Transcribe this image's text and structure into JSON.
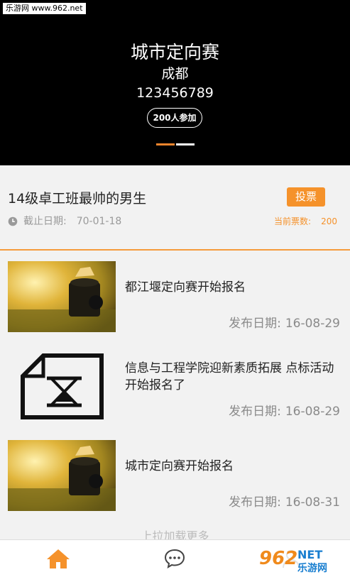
{
  "watermark": {
    "top_text": "乐游网 www.962.net",
    "logo_number": "962",
    "logo_suffix": "NET",
    "logo_text": "乐游网"
  },
  "banner": {
    "title": "城市定向赛",
    "city": "成都",
    "phone": "123456789",
    "participants": "200人参加",
    "indicator": {
      "count": 2,
      "active": 1
    },
    "colors": {
      "background": "#000000",
      "active_dot": "#f0852d"
    }
  },
  "event": {
    "name": "14级卓工班最帅的男生",
    "vote_label": "投票",
    "deadline_label": "截止日期:",
    "deadline_value": "70-01-18",
    "votes_label": "当前票数:",
    "votes_value": "200"
  },
  "news": [
    {
      "title": "都江堰定向赛开始报名",
      "date_label": "发布日期:",
      "date": "16-08-29",
      "thumb": "photo-thumbnail"
    },
    {
      "title": "信息与工程学院迎新素质拓展 点标活动开始报名了",
      "date_label": "发布日期:",
      "date": "16-08-29",
      "thumb": "hourglass-file-icon"
    },
    {
      "title": "城市定向赛开始报名",
      "date_label": "发布日期:",
      "date": "16-08-31",
      "thumb": "photo-thumbnail"
    }
  ],
  "load_more": "上拉加载更多",
  "tabs": [
    {
      "name": "home",
      "icon": "home-icon",
      "active": true
    },
    {
      "name": "message",
      "icon": "chat-icon",
      "active": false
    },
    {
      "name": "profile",
      "icon": "person-icon",
      "active": false
    }
  ],
  "colors": {
    "accent": "#f5922b",
    "muted": "#9a9a9a"
  }
}
